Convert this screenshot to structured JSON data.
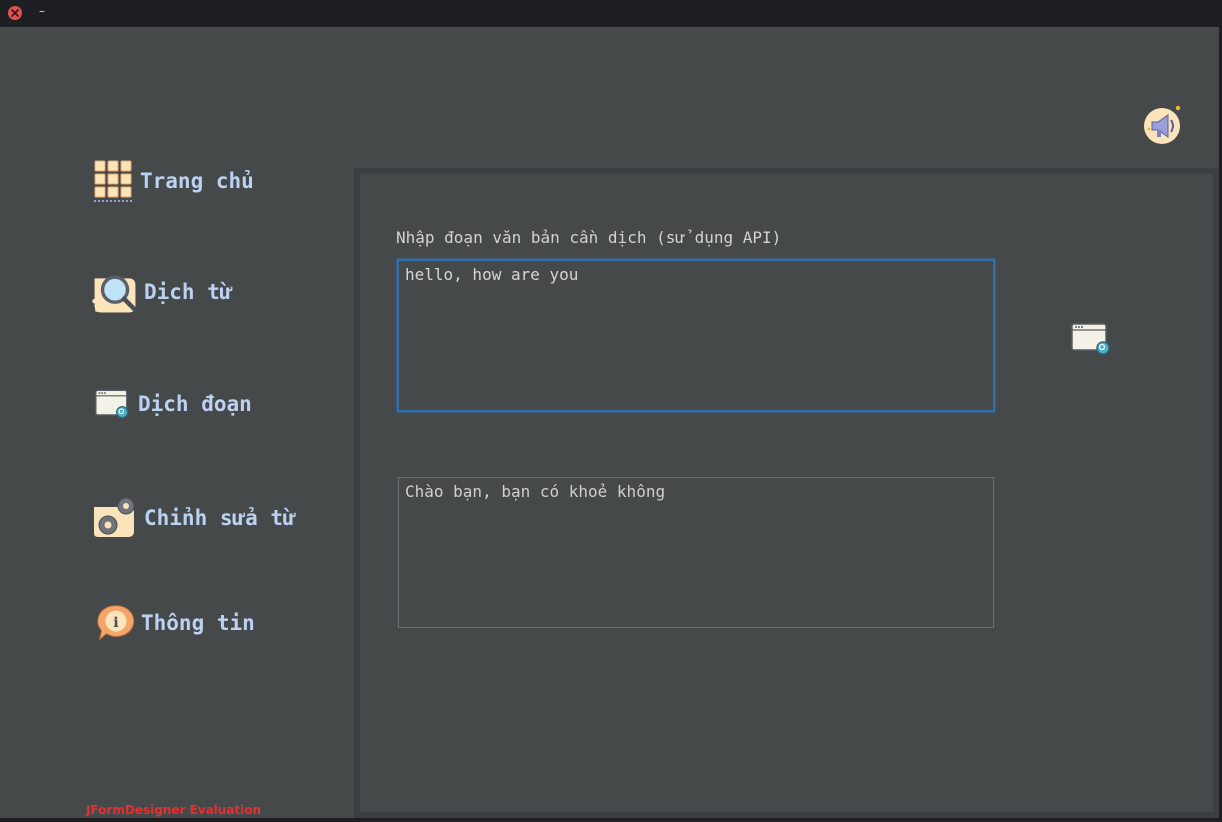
{
  "titlebar": {
    "title": "–"
  },
  "sidebar": {
    "items": [
      {
        "label": "Trang chủ",
        "icon": "grid-icon"
      },
      {
        "label": "Dịch từ",
        "icon": "magnifier-icon"
      },
      {
        "label": "Dịch đoạn",
        "icon": "window-search-icon"
      },
      {
        "label": "Chỉnh sửa từ",
        "icon": "gears-icon"
      },
      {
        "label": "Thông tin",
        "icon": "info-bubble-icon"
      }
    ]
  },
  "main": {
    "prompt": "Nhập đoạn văn bản cần dịch (sử dụng API)",
    "input_value": "hello, how are you",
    "output_value": "Chào bạn, bạn có khoẻ không"
  },
  "watermark": "JFormDesigner Evaluation",
  "colors": {
    "background": "#45494a",
    "nav_text": "#bcd2f2",
    "focus_border": "#2f6fa7",
    "watermark": "#e53030",
    "icon_cream": "#fbe3ba"
  }
}
